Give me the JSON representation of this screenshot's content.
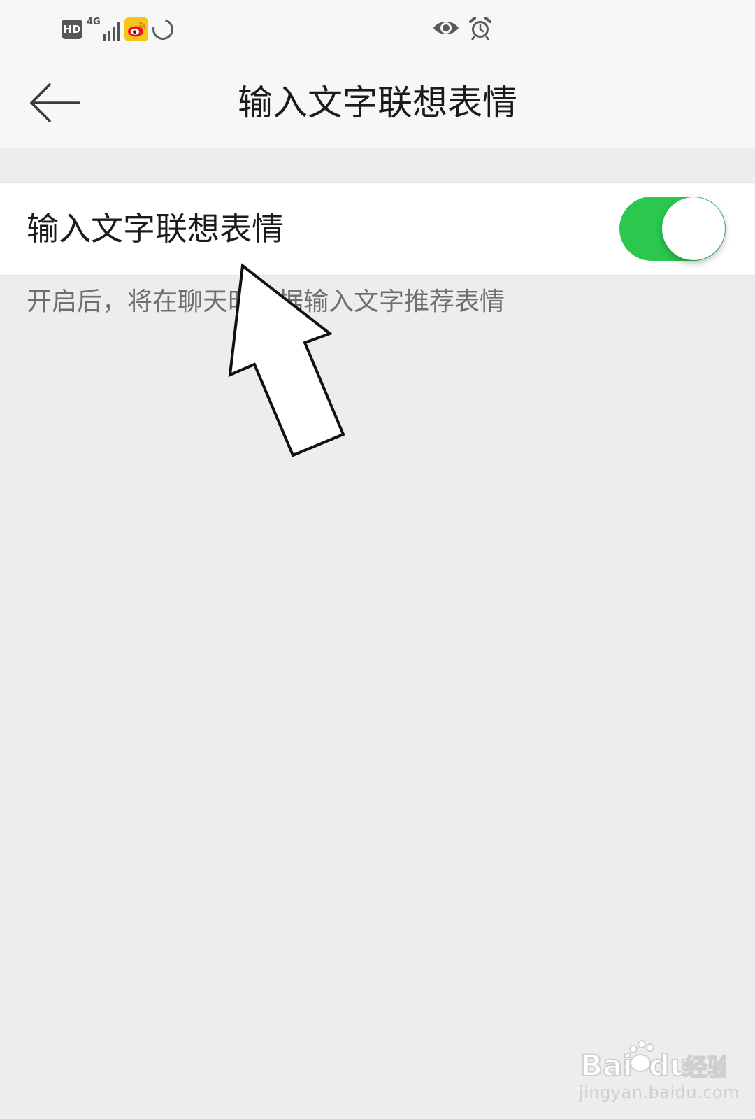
{
  "status_bar": {
    "hd_badge": "HD",
    "network_type": "4G",
    "signal_bar_levels": [
      0.35,
      0.55,
      0.75,
      1.0
    ],
    "icons": [
      "hd-icon",
      "signal-icon",
      "weibo-icon",
      "loading-icon",
      "eye-icon",
      "alarm-icon"
    ]
  },
  "header": {
    "back_icon": "back-arrow-icon",
    "title": "输入文字联想表情"
  },
  "setting": {
    "label": "输入文字联想表情",
    "toggle_on": true,
    "description": "开启后，将在聊天时根据输入文字推荐表情"
  },
  "annotation": {
    "icon": "pointer-arrow-icon"
  },
  "watermark": {
    "logo": "Bai du 经验",
    "url": "jingyan.baidu.com"
  },
  "colors": {
    "toggle_on": "#2ac84f",
    "background": "#ededed",
    "header_bg": "#f7f7f7",
    "weibo_yellow": "#f5c518"
  }
}
